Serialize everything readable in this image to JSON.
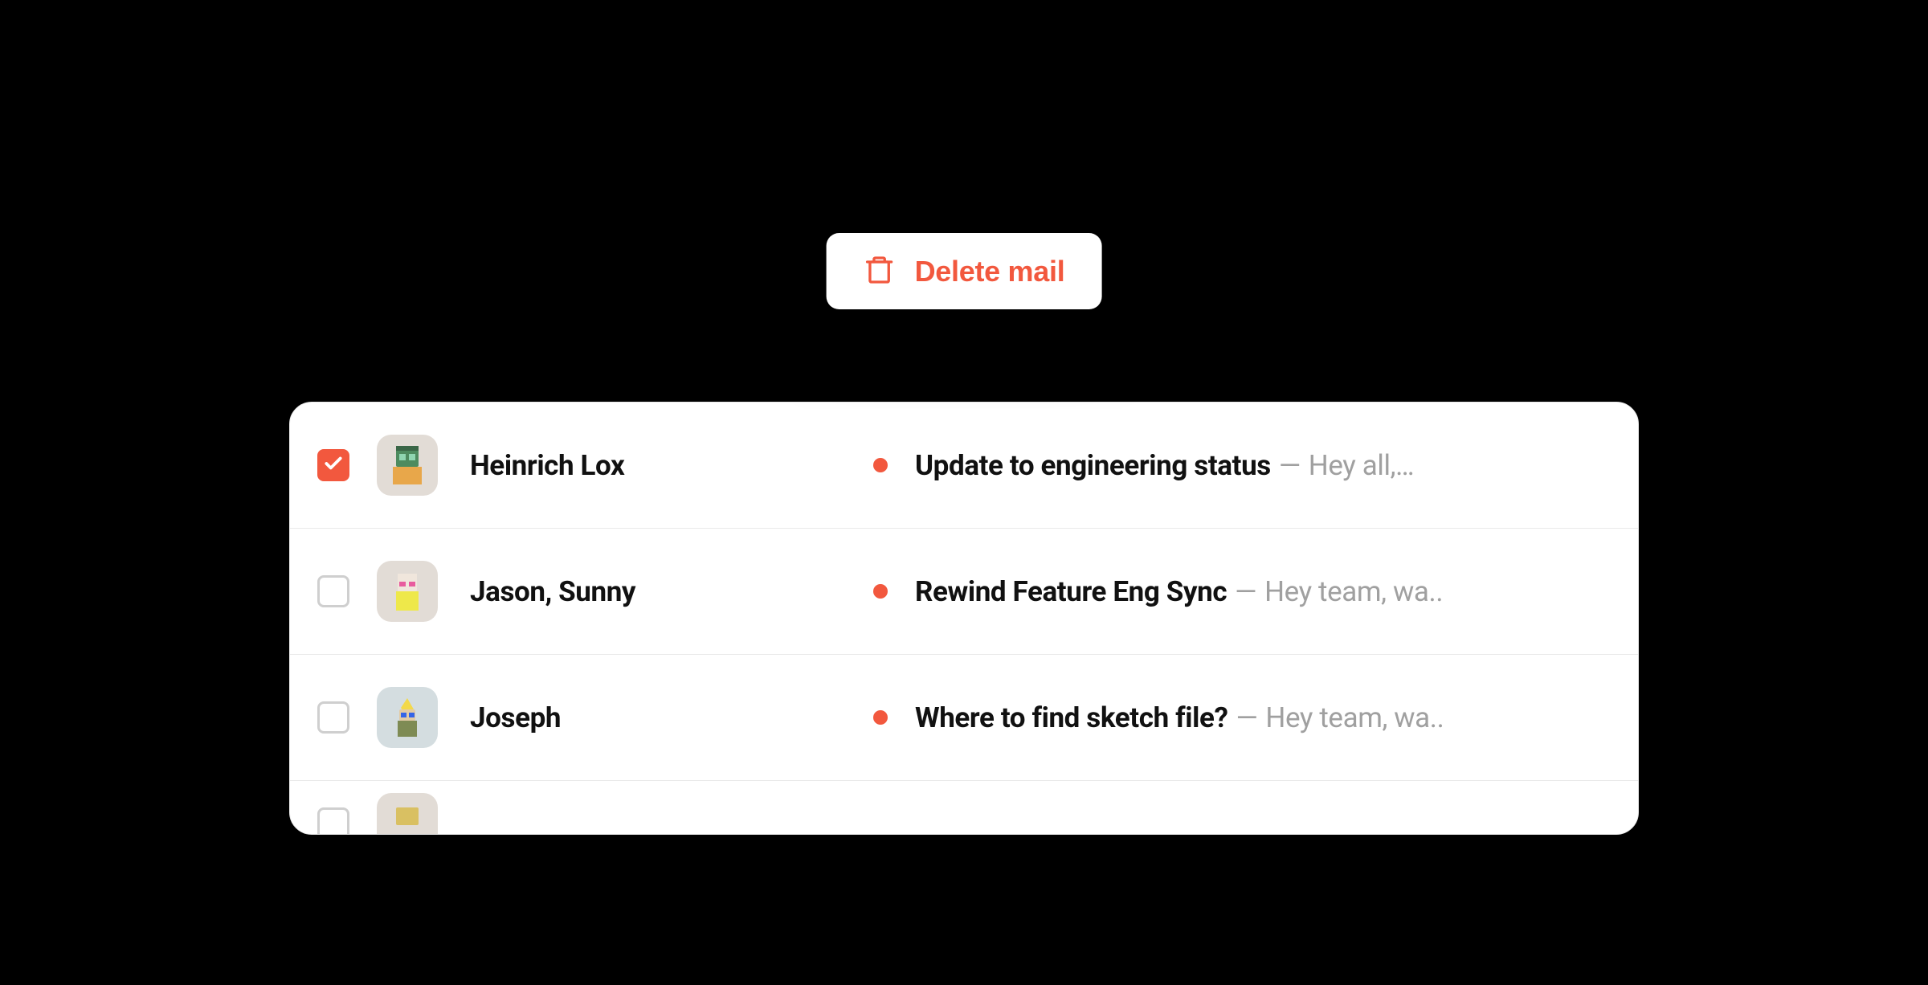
{
  "action_button": {
    "label": "Delete mail",
    "color": "#F2583E"
  },
  "rows": [
    {
      "checked": true,
      "avatar_bg": "#E2DCD6",
      "sender": "Heinrich Lox",
      "unread": true,
      "subject": "Update to engineering status",
      "preview": "Hey all,…"
    },
    {
      "checked": false,
      "avatar_bg": "#E2DCD6",
      "sender": "Jason, Sunny",
      "unread": true,
      "subject": "Rewind Feature Eng Sync",
      "preview": "Hey team, wa.."
    },
    {
      "checked": false,
      "avatar_bg": "#D4DDE0",
      "sender": "Joseph",
      "unread": true,
      "subject": "Where to find sketch file?",
      "preview": "Hey team, wa.."
    }
  ],
  "sep": "—"
}
